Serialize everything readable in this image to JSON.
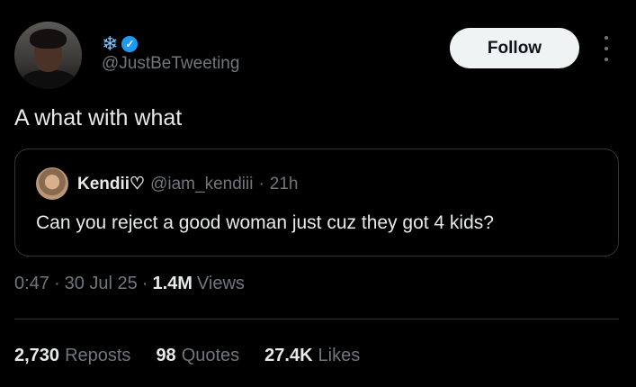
{
  "author": {
    "display_name_emoji": "❄",
    "verified_icon": "✓",
    "handle": "@JustBeTweeting"
  },
  "follow_label": "Follow",
  "tweet": {
    "text": "A what with what"
  },
  "quoted": {
    "name": "Kendii♡",
    "handle": "@iam_kendiii",
    "separator": "·",
    "time": "21h",
    "text": "Can you reject a good woman just cuz they got 4 kids?"
  },
  "meta": {
    "time": "0:47",
    "sep1": "·",
    "date": "30 Jul 25",
    "sep2": "·",
    "views_num": "1.4M",
    "views_label": "Views"
  },
  "stats": {
    "reposts_num": "2,730",
    "reposts_label": "Reposts",
    "quotes_num": "98",
    "quotes_label": "Quotes",
    "likes_num": "27.4K",
    "likes_label": "Likes"
  },
  "colors": {
    "background": "#000000",
    "text": "#e7e9ea",
    "muted": "#71767b",
    "verified": "#1d9bf0",
    "border": "#2f3336"
  }
}
